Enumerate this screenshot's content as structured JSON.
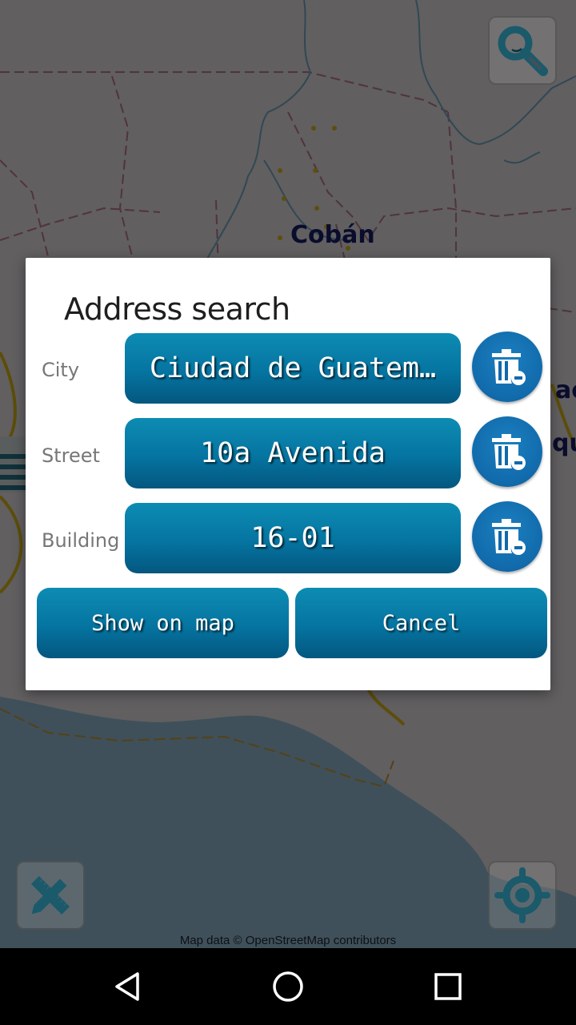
{
  "map": {
    "labels": {
      "city_coban": "Cobán",
      "partial_right_1": "ac",
      "partial_right_2": "qui"
    },
    "attribution": "Map data © OpenStreetMap contributors",
    "buttons": {
      "search": "search-icon",
      "edit_tools": "ruler-pencil-icon",
      "locate": "crosshair-location-icon"
    }
  },
  "dialog": {
    "title": "Address search",
    "rows": [
      {
        "label": "City",
        "value": "Ciudad de Guatem…",
        "clear_icon": "trash-icon"
      },
      {
        "label": "Street",
        "value": "10a Avenida",
        "clear_icon": "trash-icon"
      },
      {
        "label": "Building",
        "value": "16-01",
        "clear_icon": "trash-icon"
      }
    ],
    "show_on_map_label": "Show on map",
    "cancel_label": "Cancel"
  },
  "navbar": {
    "back": "back-triangle-icon",
    "home": "home-circle-icon",
    "recents": "recents-square-icon"
  },
  "colors": {
    "button_top": "#0d8cb3",
    "button_bottom": "#04577f",
    "trash_bg": "#116aab",
    "map_icon": "#1a6f86"
  }
}
